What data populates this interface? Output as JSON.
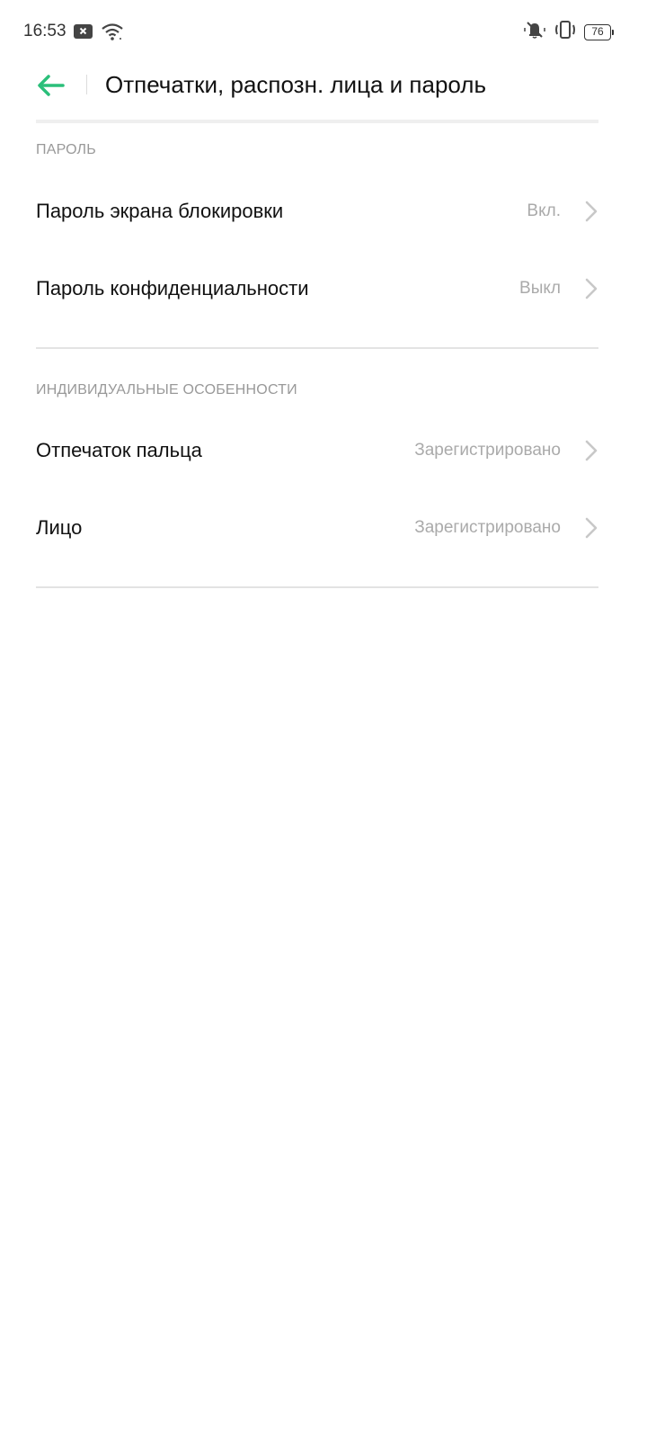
{
  "status_bar": {
    "time": "16:53",
    "battery": "76"
  },
  "header": {
    "title": "Отпечатки, распозн. лица и пароль"
  },
  "sections": [
    {
      "title": "ПАРОЛЬ",
      "items": [
        {
          "label": "Пароль экрана блокировки",
          "value": "Вкл."
        },
        {
          "label": "Пароль конфиденциальности",
          "value": "Выкл"
        }
      ]
    },
    {
      "title": "ИНДИВИДУАЛЬНЫЕ ОСОБЕННОСТИ",
      "items": [
        {
          "label": "Отпечаток пальца",
          "value": "Зарегистрировано"
        },
        {
          "label": "Лицо",
          "value": "Зарегистрировано"
        }
      ]
    }
  ],
  "colors": {
    "accent": "#2bbf7a",
    "secondary_text": "#aaaaaa"
  },
  "icons": {
    "back": "arrow-left-icon",
    "chevron": "chevron-right-icon",
    "notification": "close-box-icon",
    "wifi": "wifi-icon",
    "mute": "bell-off-icon",
    "vibrate": "vibrate-icon"
  }
}
